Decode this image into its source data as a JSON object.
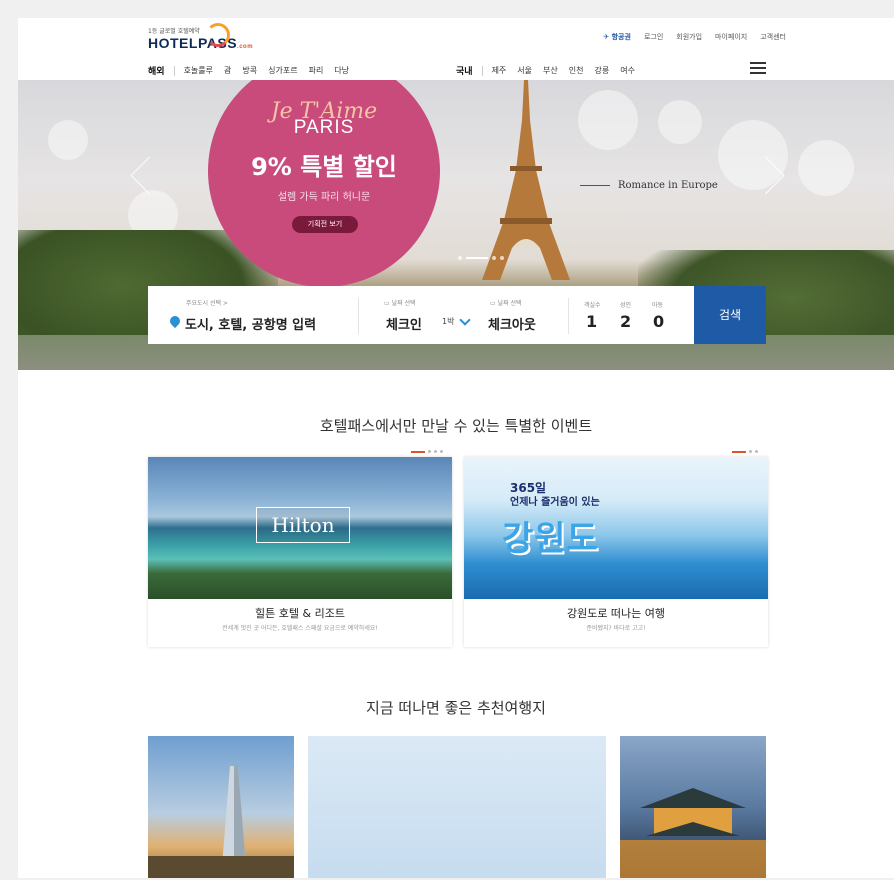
{
  "header": {
    "logo_tag": "1등 글로벌 호텔예약",
    "logo_name": "HOTELPASS",
    "logo_suffix": ".com",
    "utility_links": [
      "항공권",
      "로그인",
      "회원가입",
      "마이페이지",
      "고객센터"
    ],
    "nav_overseas_label": "해외",
    "nav_overseas_items": [
      "호놀룰루",
      "괌",
      "방콕",
      "싱가포르",
      "파리",
      "다낭"
    ],
    "nav_domestic_label": "국내",
    "nav_domestic_items": [
      "제주",
      "서울",
      "부산",
      "인천",
      "강릉",
      "여수"
    ]
  },
  "hero": {
    "script_text": "Je T'Aime",
    "city": "PARIS",
    "headline": "9% 특별 할인",
    "subtitle": "설렘 가득 파리 허니문",
    "cta": "기획전 보기",
    "tagline": "Romance in Europe"
  },
  "search": {
    "city_label": "주요도시 선택 >",
    "city_placeholder": "도시, 호텔, 공항명 입력",
    "checkin_label": "날짜 선택",
    "checkin_value": "체크인",
    "nights": "1박",
    "checkout_label": "날짜 선택",
    "checkout_value": "체크아웃",
    "rooms_label": "객실수",
    "rooms_value": "1",
    "adults_label": "성인",
    "adults_value": "2",
    "children_label": "아동",
    "children_value": "0",
    "button": "검색"
  },
  "events": {
    "title": "호텔패스에서만 만날 수 있는 특별한 이벤트",
    "cards": [
      {
        "title": "힐튼 호텔 & 리조트",
        "subtitle": "전세계 멋진 곳 어디든, 호텔패스 스페셜 요금으로 예약하세요!",
        "image_text": "Hilton"
      },
      {
        "title": "강원도로 떠나는 여행",
        "subtitle": "준비됐지? 바다로 고고!",
        "image_text_top": "365일",
        "image_text_sub": "언제나 즐거움이 있는",
        "image_text_big": "강원도"
      }
    ]
  },
  "destinations": {
    "title": "지금 떠나면 좋은 추천여행지"
  },
  "colors": {
    "brand_navy": "#0d2b55",
    "search_button": "#1f5aa6",
    "hero_circle": "#c84b7c",
    "accent_orange": "#e0522b"
  }
}
